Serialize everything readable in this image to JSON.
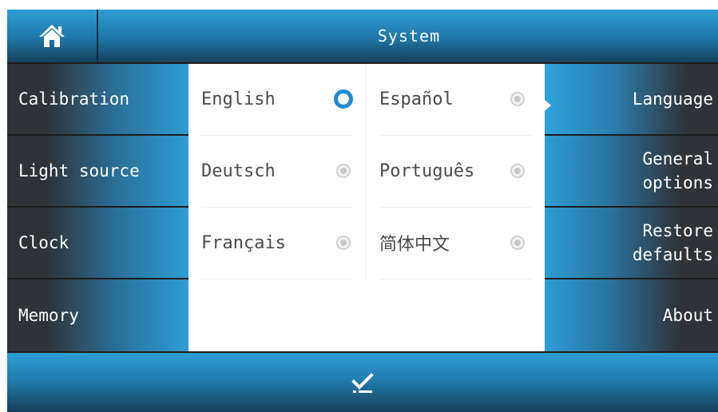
{
  "header": {
    "home_icon": "home-icon",
    "title": "System"
  },
  "left_menu": [
    {
      "label": "Calibration"
    },
    {
      "label": "Light source"
    },
    {
      "label": "Clock"
    },
    {
      "label": "Memory"
    }
  ],
  "right_menu": [
    {
      "label": "Language",
      "active": true
    },
    {
      "label_line1": "General",
      "label_line2": "options"
    },
    {
      "label_line1": "Restore",
      "label_line2": "defaults"
    },
    {
      "label": "About"
    }
  ],
  "languages": [
    {
      "name": "English",
      "selected": true
    },
    {
      "name": "Deutsch",
      "selected": false
    },
    {
      "name": "Français",
      "selected": false
    },
    {
      "name": "Español",
      "selected": false
    },
    {
      "name": "Português",
      "selected": false
    },
    {
      "name": "简体中文",
      "selected": false
    }
  ],
  "footer": {
    "confirm_icon": "checkmark-icon"
  },
  "colors": {
    "accent": "#2e9dd6",
    "dark": "#2f3337",
    "radio_selected": "#1e8ad0"
  }
}
